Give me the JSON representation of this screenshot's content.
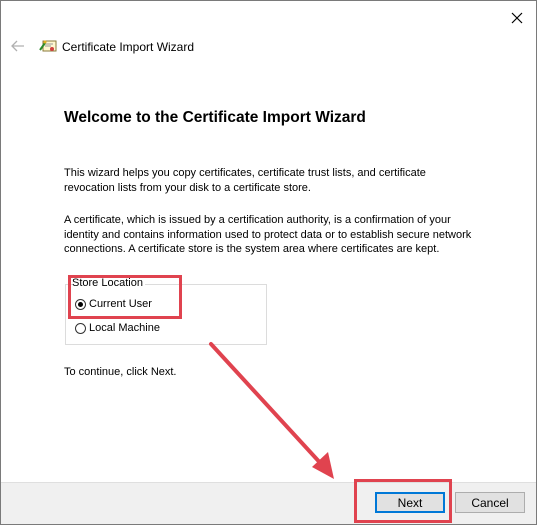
{
  "window": {
    "title": "Certificate Import Wizard",
    "close_glyph": "✕",
    "back_glyph": "←"
  },
  "content": {
    "heading": "Welcome to the Certificate Import Wizard",
    "paragraph1": "This wizard helps you copy certificates, certificate trust lists, and certificate revocation lists from your disk to a certificate store.",
    "paragraph2": "A certificate, which is issued by a certification authority, is a confirmation of your identity and contains information used to protect data or to establish secure network connections. A certificate store is the system area where certificates are kept.",
    "store_location": {
      "label": "Store Location",
      "options": [
        {
          "label": "Current User",
          "selected": true
        },
        {
          "label": "Local Machine",
          "selected": false
        }
      ]
    },
    "continue_text": "To continue, click Next."
  },
  "footer": {
    "next_label": "Next",
    "cancel_label": "Cancel"
  },
  "colors": {
    "annotation_red": "#e0434f",
    "footer_bg": "#f0f0f0",
    "default_button_border": "#0078d7"
  },
  "icons": [
    "close-icon",
    "back-arrow-icon",
    "certificate-wizard-icon",
    "annotation-arrow"
  ]
}
